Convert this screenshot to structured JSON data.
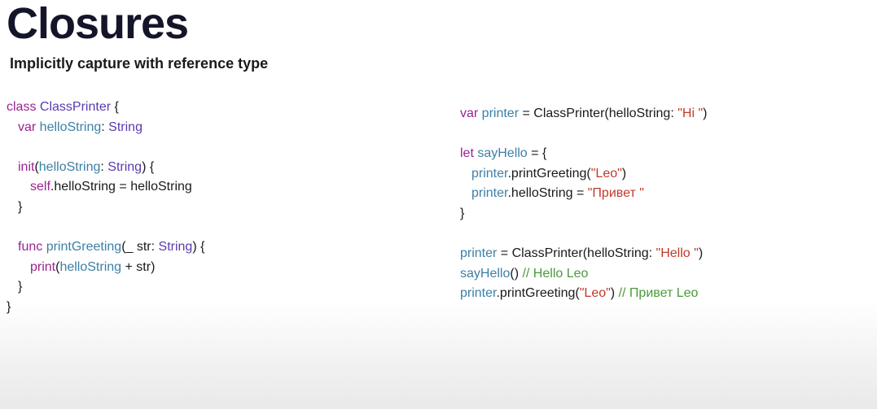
{
  "slide": {
    "title": "Closures",
    "subtitle": "Implicitly capture with reference type"
  },
  "left_code": [
    [
      {
        "t": "class ",
        "c": "kw"
      },
      {
        "t": "ClassPrinter",
        "c": "ty"
      },
      {
        "t": " {",
        "c": "pl"
      }
    ],
    [
      {
        "t": "var ",
        "c": "kw"
      },
      {
        "t": "helloString",
        "c": "id"
      },
      {
        "t": ": ",
        "c": "pl"
      },
      {
        "t": "String",
        "c": "ty"
      }
    ],
    [],
    [
      {
        "t": "init",
        "c": "kw"
      },
      {
        "t": "(",
        "c": "pl"
      },
      {
        "t": "helloString",
        "c": "id"
      },
      {
        "t": ": ",
        "c": "pl"
      },
      {
        "t": "String",
        "c": "ty"
      },
      {
        "t": ") {",
        "c": "pl"
      }
    ],
    [
      {
        "t": "self",
        "c": "kw"
      },
      {
        "t": ".helloString = helloString",
        "c": "pl"
      }
    ],
    [
      {
        "t": "}",
        "c": "pl"
      }
    ],
    [],
    [
      {
        "t": "func ",
        "c": "kw"
      },
      {
        "t": "printGreeting",
        "c": "id"
      },
      {
        "t": "(_ str: ",
        "c": "pl"
      },
      {
        "t": "String",
        "c": "ty"
      },
      {
        "t": ") {",
        "c": "pl"
      }
    ],
    [
      {
        "t": "print",
        "c": "kw"
      },
      {
        "t": "(",
        "c": "pl"
      },
      {
        "t": "helloString",
        "c": "id"
      },
      {
        "t": " + str)",
        "c": "pl"
      }
    ],
    [
      {
        "t": "}",
        "c": "pl"
      }
    ],
    [
      {
        "t": "}",
        "c": "pl"
      }
    ]
  ],
  "left_indent": [
    0,
    1,
    0,
    1,
    2,
    1,
    0,
    1,
    2,
    1,
    0
  ],
  "right_code": [
    [
      {
        "t": "var ",
        "c": "kw"
      },
      {
        "t": "printer",
        "c": "id"
      },
      {
        "t": " = ClassPrinter(helloString: ",
        "c": "pl"
      },
      {
        "t": "\"Hi \"",
        "c": "str"
      },
      {
        "t": ")",
        "c": "pl"
      }
    ],
    [],
    [
      {
        "t": "let ",
        "c": "kw"
      },
      {
        "t": "sayHello",
        "c": "id"
      },
      {
        "t": " = {",
        "c": "pl"
      }
    ],
    [
      {
        "t": "printer",
        "c": "id"
      },
      {
        "t": ".printGreeting(",
        "c": "pl"
      },
      {
        "t": "\"Leo\"",
        "c": "str"
      },
      {
        "t": ")",
        "c": "pl"
      }
    ],
    [
      {
        "t": "printer",
        "c": "id"
      },
      {
        "t": ".helloString = ",
        "c": "pl"
      },
      {
        "t": "\"Привет \"",
        "c": "str"
      }
    ],
    [
      {
        "t": "}",
        "c": "pl"
      }
    ],
    [],
    [
      {
        "t": "printer",
        "c": "id"
      },
      {
        "t": " = ClassPrinter(helloString: ",
        "c": "pl"
      },
      {
        "t": "\"Hello \"",
        "c": "str"
      },
      {
        "t": ")",
        "c": "pl"
      }
    ],
    [
      {
        "t": "sayHello",
        "c": "id"
      },
      {
        "t": "() ",
        "c": "pl"
      },
      {
        "t": "// Hello Leo",
        "c": "cm"
      }
    ],
    [
      {
        "t": "printer",
        "c": "id"
      },
      {
        "t": ".printGreeting(",
        "c": "pl"
      },
      {
        "t": "\"Leo\"",
        "c": "str"
      },
      {
        "t": ") ",
        "c": "pl"
      },
      {
        "t": "// Привет Leo",
        "c": "cm"
      }
    ]
  ],
  "right_indent": [
    0,
    0,
    0,
    1,
    1,
    0,
    0,
    0,
    0,
    0
  ],
  "colors": {
    "keyword": "#9b2393",
    "identifier": "#3d7fa6",
    "type": "#5b3ab0",
    "string": "#c0392b",
    "comment": "#4a9a3a",
    "plain": "#1a1a1a"
  }
}
